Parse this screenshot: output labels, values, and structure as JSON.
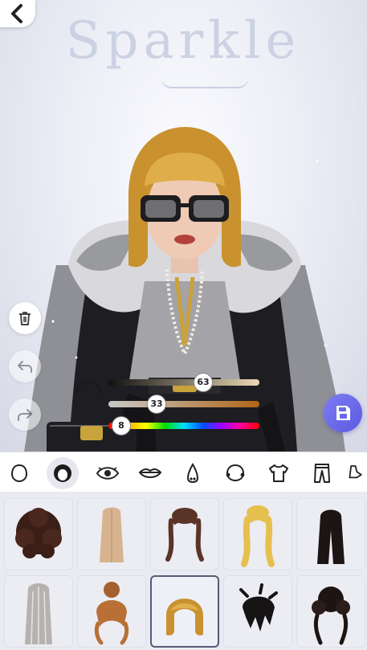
{
  "logo_text": "Sparkle",
  "colors": {
    "accent": "#6b69ea",
    "stage_bg": "#eceef6",
    "panel_bg": "#eaeaf2"
  },
  "left_controls": [
    {
      "name": "delete",
      "icon": "trash-icon"
    },
    {
      "name": "undo",
      "icon": "undo-icon",
      "enabled": false
    },
    {
      "name": "redo",
      "icon": "redo-icon",
      "enabled": false
    }
  ],
  "sliders": [
    {
      "name": "hair-shade",
      "value": "63"
    },
    {
      "name": "hair-saturation",
      "value": "33"
    },
    {
      "name": "hair-hue",
      "value": "8"
    }
  ],
  "toolbar": {
    "tabs": [
      "face-shape",
      "hair",
      "eyes",
      "lips",
      "nose",
      "ears",
      "tops",
      "bottoms",
      "more"
    ],
    "active_tab": "hair"
  },
  "hair_items": [
    {
      "id": "curly-dark",
      "selected": false
    },
    {
      "id": "long-straight-blonde",
      "selected": false
    },
    {
      "id": "updo-wavy-brown",
      "selected": false
    },
    {
      "id": "blonde-braided",
      "selected": false
    },
    {
      "id": "long-black",
      "selected": false
    },
    {
      "id": "long-silver",
      "selected": false
    },
    {
      "id": "bun-auburn",
      "selected": false
    },
    {
      "id": "blonde-bob",
      "selected": true
    },
    {
      "id": "messy-black",
      "selected": false
    },
    {
      "id": "curly-bun-dark",
      "selected": false
    }
  ]
}
